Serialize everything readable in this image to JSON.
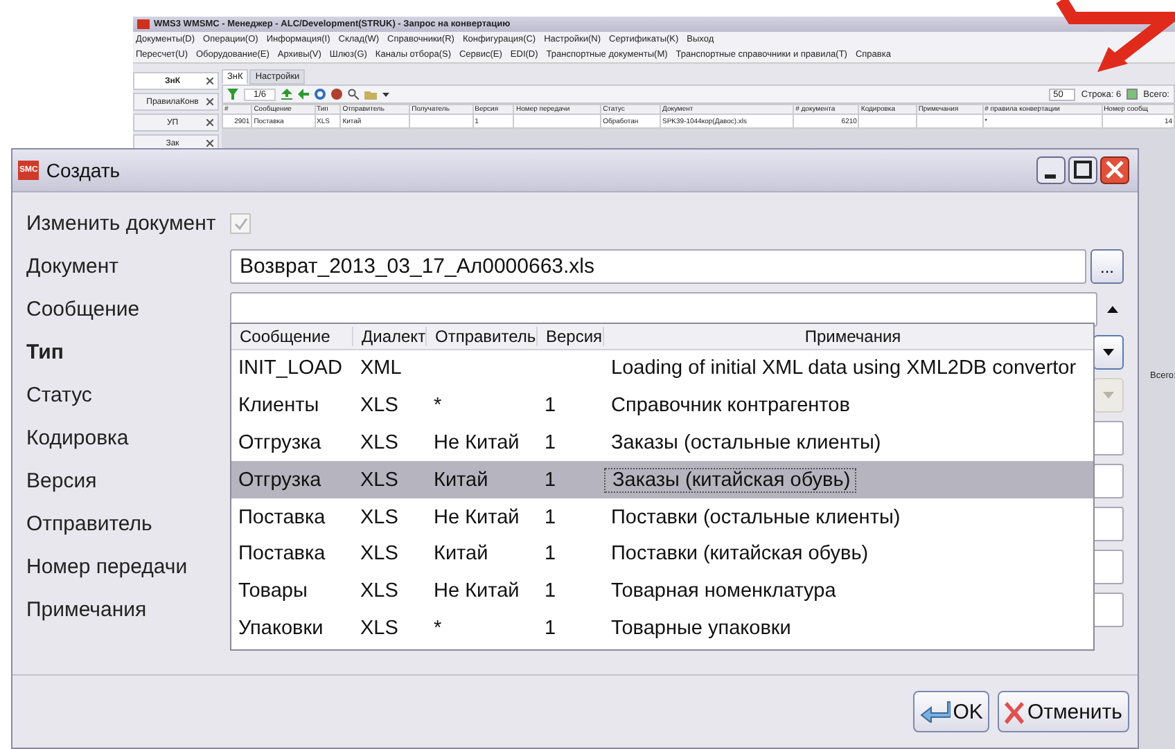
{
  "app": {
    "title": "WMS3 WMSMC - Менеджер - ALC/Development(STRUK) - Запрос на конвертацию",
    "menu_rows": [
      [
        "Документы(D)",
        "Операции(O)",
        "Информация(I)",
        "Склад(W)",
        "Справочники(R)",
        "Конфигурация(C)",
        "Настройки(N)",
        "Сертификаты(K)",
        "Выход"
      ],
      [
        "Пересчет(U)",
        "Оборудование(E)",
        "Архивы(V)",
        "Шлюз(G)",
        "Каналы отбора(S)",
        "Сервис(E)",
        "EDI(D)",
        "Транспортные документы(M)",
        "Транспортные справочники и правила(T)",
        "Справка"
      ]
    ],
    "side_tabs": [
      {
        "label": "ЗнК",
        "selected": true
      },
      {
        "label": "ПравилаКонв",
        "selected": false
      },
      {
        "label": "УП",
        "selected": false
      },
      {
        "label": "Зак",
        "selected": false
      }
    ],
    "tabs": [
      {
        "label": "ЗнК",
        "selected": true
      },
      {
        "label": "Настройки",
        "selected": false
      }
    ],
    "toolbar": {
      "page": "1/6",
      "page_size": "50",
      "row_label": "Строка: 6",
      "show_all_checked": true,
      "total_label": "Всего:"
    },
    "table": {
      "columns": [
        "#",
        "Сообщение",
        "Тип",
        "Отправитель",
        "Получатель",
        "Версия",
        "Номер передачи",
        "Статус",
        "Документ",
        "# документа",
        "Кодировка",
        "Примечания",
        "# правила конвертации",
        "Номер сообщ"
      ],
      "rows": [
        [
          "2901",
          "Поставка",
          "XLS",
          "Китай",
          "",
          "1",
          "",
          "Обработан",
          "SPK39-1044кор(Давос).xls",
          "6210",
          "",
          "",
          "*",
          "14"
        ]
      ]
    },
    "side_total": "Всего:"
  },
  "dialog": {
    "title": "Создать",
    "logo": "SMC",
    "fields": [
      {
        "label": "Изменить документ",
        "kind": "checkbox",
        "checked": true,
        "disabled": true,
        "required": false
      },
      {
        "label": "Документ",
        "kind": "file",
        "value": "Возврат_2013_03_17_Ал0000663.xls",
        "disabled": false,
        "required": false,
        "browse": "..."
      },
      {
        "label": "Сообщение",
        "kind": "combo",
        "expanded": true,
        "disabled": false,
        "required": false
      },
      {
        "label": "Тип",
        "kind": "select",
        "disabled": false,
        "required": true
      },
      {
        "label": "Статус",
        "kind": "select",
        "disabled": true,
        "required": false
      },
      {
        "label": "Кодировка",
        "kind": "text",
        "disabled": false,
        "required": false
      },
      {
        "label": "Версия",
        "kind": "text",
        "disabled": false,
        "required": false
      },
      {
        "label": "Отправитель",
        "kind": "text",
        "disabled": false,
        "required": false
      },
      {
        "label": "Номер передачи",
        "kind": "text",
        "disabled": false,
        "required": false
      },
      {
        "label": "Примечания",
        "kind": "text",
        "disabled": false,
        "required": false
      }
    ],
    "dropdown": {
      "columns": [
        "Сообщение",
        "Диалект",
        "Отправитель",
        "Версия",
        "Примечания"
      ],
      "rows": [
        {
          "cells": [
            "INIT_LOAD",
            "XML",
            "",
            "",
            "Loading of initial XML data using XML2DB convertor"
          ],
          "selected": false
        },
        {
          "cells": [
            "Клиенты",
            "XLS",
            "*",
            "1",
            "Справочник контрагентов"
          ],
          "selected": false
        },
        {
          "cells": [
            "Отгрузка",
            "XLS",
            "Не Китай",
            "1",
            "Заказы (остальные клиенты)"
          ],
          "selected": false
        },
        {
          "cells": [
            "Отгрузка",
            "XLS",
            "Китай",
            "1",
            "Заказы (китайская обувь)"
          ],
          "selected": true
        },
        {
          "cells": [
            "Поставка",
            "XLS",
            "Не Китай",
            "1",
            "Поставки (остальные клиенты)"
          ],
          "selected": false
        },
        {
          "cells": [
            "Поставка",
            "XLS",
            "Китай",
            "1",
            "Поставки (китайская обувь)"
          ],
          "selected": false
        },
        {
          "cells": [
            "Товары",
            "XLS",
            "Не Китай",
            "1",
            "Товарная номенклатура"
          ],
          "selected": false
        },
        {
          "cells": [
            "Упаковки",
            "XLS",
            "*",
            "1",
            "Товарные упаковки"
          ],
          "selected": false
        }
      ]
    },
    "buttons": [
      {
        "label": "OK",
        "kind": "ok"
      },
      {
        "label": "Отменить",
        "kind": "cancel"
      }
    ]
  }
}
